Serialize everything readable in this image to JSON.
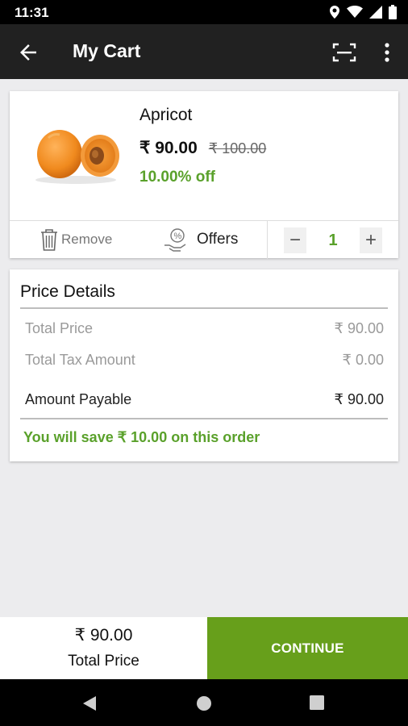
{
  "status_bar": {
    "time": "11:31",
    "icons": [
      "location-icon",
      "wifi-icon",
      "signal-icon",
      "battery-icon"
    ]
  },
  "app_bar": {
    "title": "My Cart",
    "icons": [
      "back-arrow-icon",
      "scan-icon",
      "more-vert-icon"
    ]
  },
  "cart_item": {
    "name": "Apricot",
    "price": "₹ 90.00",
    "mrp": "₹ 100.00",
    "discount": "10.00% off",
    "remove_label": "Remove",
    "offers_label": "Offers",
    "quantity": "1",
    "minus": "−",
    "plus": "+"
  },
  "price_details": {
    "title": "Price Details",
    "rows": [
      {
        "label": "Total Price",
        "value": "₹ 90.00"
      },
      {
        "label": "Total Tax Amount",
        "value": "₹ 0.00"
      },
      {
        "label": "Amount Payable",
        "value": "₹ 90.00"
      }
    ],
    "savings": "You will save ₹ 10.00 on this order"
  },
  "bottom_bar": {
    "total_price": "₹ 90.00",
    "total_label": "Total Price",
    "continue_label": "CONTINUE"
  },
  "nav_bar": {
    "icons": [
      "nav-back-icon",
      "nav-home-icon",
      "nav-recents-icon"
    ]
  },
  "colors": {
    "accent_green": "#5aa12b",
    "button_green": "#679f1b",
    "app_bar": "#212121"
  }
}
